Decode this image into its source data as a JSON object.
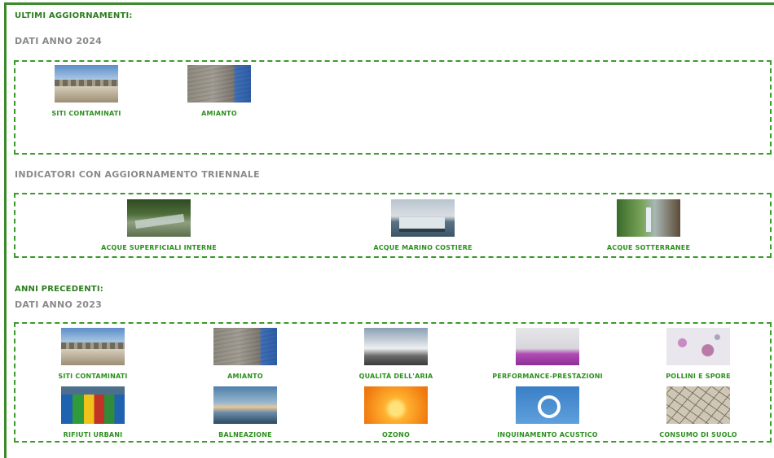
{
  "latest": {
    "heading": "ULTIMI AGGIORNAMENTI:",
    "year_label": "DATI ANNO 2024",
    "items": [
      {
        "label": "SITI CONTAMINATI",
        "icon": "contaminated-sites-photo"
      },
      {
        "label": "AMIANTO",
        "icon": "asbestos-photo"
      }
    ]
  },
  "triennial": {
    "heading": "INDICATORI CON AGGIORNAMENTO TRIENNALE",
    "items": [
      {
        "label": "ACQUE SUPERFICIALI INTERNE",
        "icon": "river-photo"
      },
      {
        "label": "ACQUE MARINO COSTIERE",
        "icon": "boat-photo"
      },
      {
        "label": "ACQUE SOTTERRANEE",
        "icon": "groundwater-photo"
      }
    ]
  },
  "previous": {
    "heading": "ANNI PRECEDENTI:",
    "year_label": "DATI ANNO 2023",
    "items": [
      {
        "label": "SITI CONTAMINATI",
        "icon": "contaminated-sites-photo"
      },
      {
        "label": "AMIANTO",
        "icon": "asbestos-photo"
      },
      {
        "label": "QUALITÀ DELL'ARIA",
        "icon": "air-quality-photo"
      },
      {
        "label": "PERFORMANCE-PRESTAZIONI",
        "icon": "lab-photo"
      },
      {
        "label": "POLLINI E SPORE",
        "icon": "pollen-photo"
      },
      {
        "label": "RIFIUTI URBANI",
        "icon": "waste-bins-photo"
      },
      {
        "label": "BALNEAZIONE",
        "icon": "beach-photo"
      },
      {
        "label": "OZONO",
        "icon": "sun-photo"
      },
      {
        "label": "INQUINAMENTO ACUSTICO",
        "icon": "ear-protection-sign"
      },
      {
        "label": "CONSUMO DI SUOLO",
        "icon": "cracked-soil-photo"
      }
    ]
  },
  "colors": {
    "accent": "#2d8f1f",
    "border": "#3a8a2a",
    "subheading": "#8a8a8a"
  }
}
